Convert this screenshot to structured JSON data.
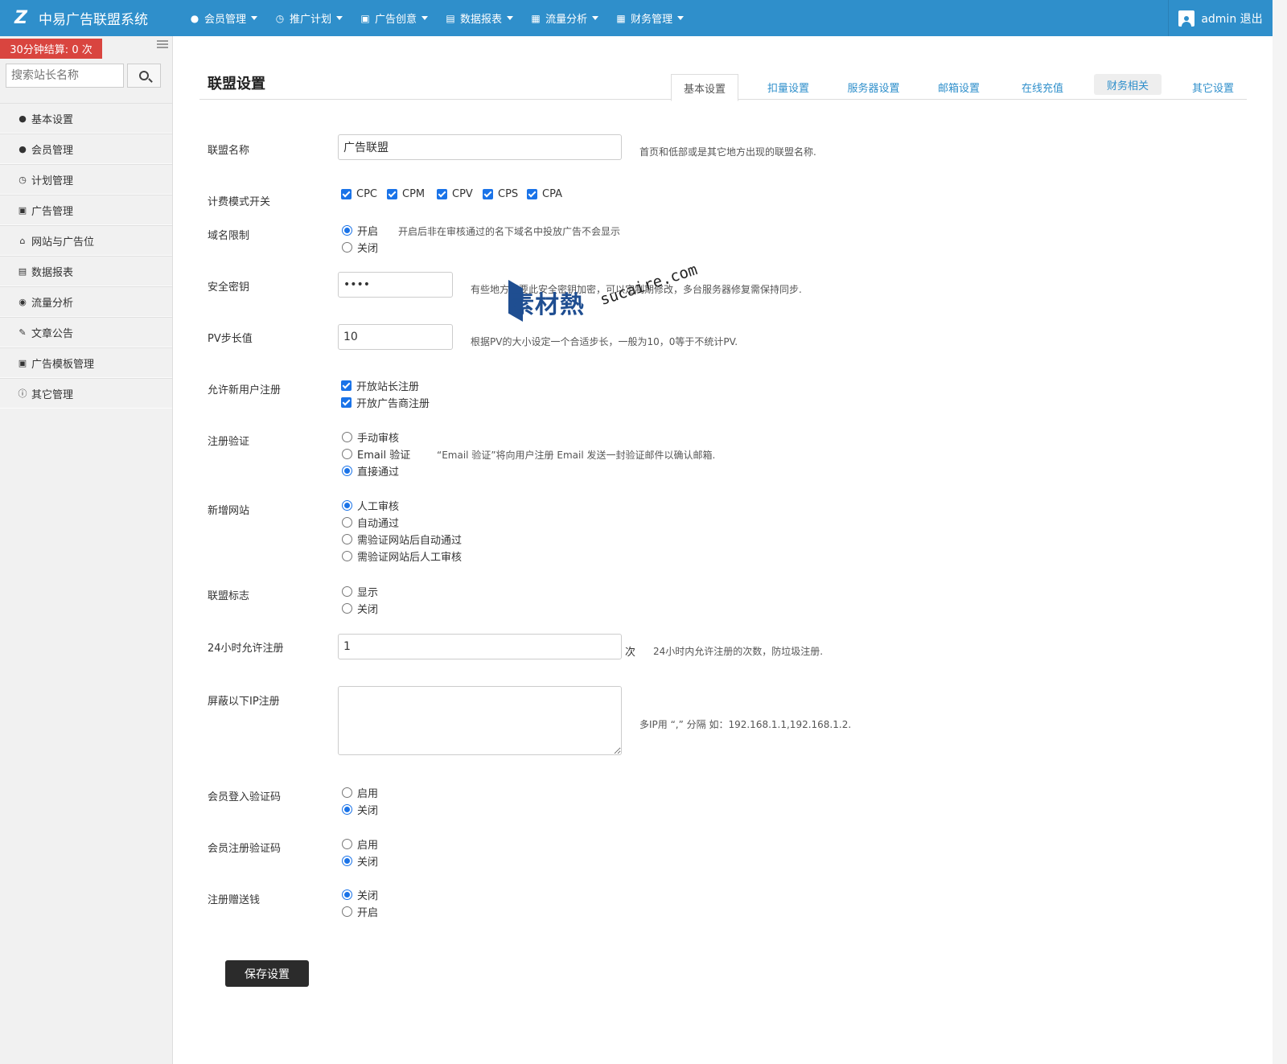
{
  "app": {
    "title": "中易广告联盟系统",
    "logo_letter": "Z"
  },
  "nav": [
    {
      "label": "会员管理",
      "icon": "user-icon"
    },
    {
      "label": "推广计划",
      "icon": "clock-icon"
    },
    {
      "label": "广告创意",
      "icon": "picture-icon"
    },
    {
      "label": "数据报表",
      "icon": "list-icon"
    },
    {
      "label": "流量分析",
      "icon": "signal-icon"
    },
    {
      "label": "财务管理",
      "icon": "grid-icon"
    }
  ],
  "user": {
    "label": "admin 退出"
  },
  "sidebar": {
    "badge": "30分钟结算: 0 次",
    "search_placeholder": "搜索站长名称",
    "items": [
      {
        "label": "基本设置",
        "icon": "map-marker-icon"
      },
      {
        "label": "会员管理",
        "icon": "user-icon"
      },
      {
        "label": "计划管理",
        "icon": "clock-icon"
      },
      {
        "label": "广告管理",
        "icon": "picture-icon"
      },
      {
        "label": "网站与广告位",
        "icon": "home-icon"
      },
      {
        "label": "数据报表",
        "icon": "list-icon"
      },
      {
        "label": "流量分析",
        "icon": "eye-icon"
      },
      {
        "label": "文章公告",
        "icon": "pencil-icon"
      },
      {
        "label": "广告模板管理",
        "icon": "picture-icon"
      },
      {
        "label": "其它管理",
        "icon": "info-icon"
      }
    ]
  },
  "page": {
    "title": "联盟设置"
  },
  "tabs": [
    "基本设置",
    "扣量设置",
    "服务器设置",
    "邮箱设置",
    "在线充值",
    "财务相关",
    "其它设置"
  ],
  "form": {
    "union_name": {
      "label": "联盟名称",
      "value": "广告联盟",
      "help": "首页和低部或是其它地方出现的联盟名称."
    },
    "billing": {
      "label": "计费模式开关",
      "options": [
        "CPC",
        "CPM",
        "CPV",
        "CPS",
        "CPA"
      ]
    },
    "domain": {
      "label": "域名限制",
      "options": [
        "开启",
        "关闭"
      ],
      "help": "开启后非在审核通过的名下域名中投放广告不会显示"
    },
    "secret": {
      "label": "安全密钥",
      "value": "••••",
      "help": "有些地方需要此安全密钥加密，可以定制期修改，多台服务器修复需保持同步."
    },
    "pv_step": {
      "label": "PV步长值",
      "value": "10",
      "help": "根据PV的大小设定一个合适步长，一般为10，0等于不统计PV."
    },
    "allow_reg": {
      "label": "允许新用户注册",
      "options": [
        "开放站长注册",
        "开放广告商注册"
      ]
    },
    "reg_verify": {
      "label": "注册验证",
      "options": [
        "手动审核",
        "Email 验证",
        "直接通过"
      ],
      "help": "“Email 验证”将向用户注册 Email 发送一封验证邮件以确认邮箱."
    },
    "new_site": {
      "label": "新增网站",
      "options": [
        "人工审核",
        "自动通过",
        "需验证网站后自动通过",
        "需验证网站后人工审核"
      ]
    },
    "union_logo": {
      "label": "联盟标志",
      "options": [
        "显示",
        "关闭"
      ]
    },
    "reg_24h": {
      "label": "24小时允许注册",
      "value": "1",
      "unit": "次",
      "help": "24小时内允许注册的次数，防垃圾注册."
    },
    "block_ip": {
      "label": "屏蔽以下IP注册",
      "value": "",
      "help": "多IP用 “,” 分隔 如：192.168.1.1,192.168.1.2."
    },
    "login_captcha": {
      "label": "会员登入验证码",
      "options": [
        "启用",
        "关闭"
      ]
    },
    "reg_captcha": {
      "label": "会员注册验证码",
      "options": [
        "启用",
        "关闭"
      ]
    },
    "reg_bonus": {
      "label": "注册赠送钱",
      "options": [
        "关闭",
        "开启"
      ]
    },
    "save_label": "保存设置"
  },
  "watermark": {
    "cn": "素材熱",
    "en": "sucaire.com"
  }
}
